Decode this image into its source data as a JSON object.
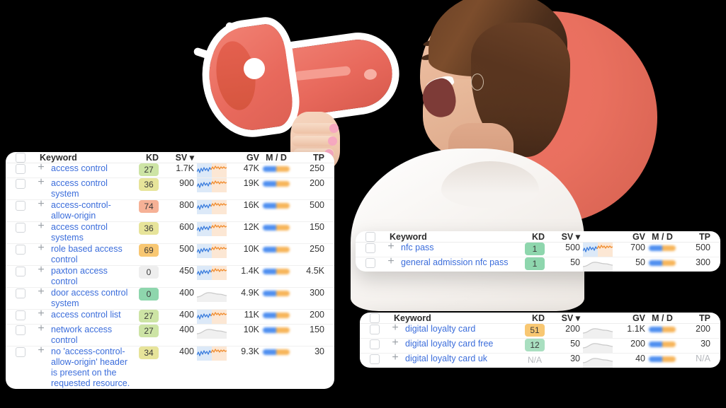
{
  "theme": {
    "accent_red": "#e8695c",
    "link_blue": "#3b6ddb",
    "kd_green": "#8ed6ad",
    "kd_light_green": "#cde4a5",
    "kd_yellow": "#e7e49a",
    "kd_orange": "#f8c772",
    "kd_salmon": "#f6b196",
    "kd_grey": "#eeeeee",
    "md_blue": "#4f8ff0",
    "md_orange": "#f7b55a"
  },
  "icons": {
    "checkbox": "checkbox-icon",
    "plus": "plus-icon",
    "sort_caret": "caret-down-icon",
    "megaphone": "megaphone-icon"
  },
  "columns": {
    "keyword": "Keyword",
    "kd": "KD",
    "sv": "SV",
    "sv_sort": "▾",
    "gv": "GV",
    "md": "M / D",
    "tp": "TP"
  },
  "tables": [
    {
      "id": "keywords-main",
      "rows": [
        {
          "keyword": "access control",
          "kd": "27",
          "kd_color": "#cde4a5",
          "sv": "1.7K",
          "gv": "47K",
          "tp": "250",
          "spark": "up"
        },
        {
          "keyword": "access control system",
          "kd": "36",
          "kd_color": "#e7e49a",
          "sv": "900",
          "gv": "19K",
          "tp": "200",
          "spark": "up"
        },
        {
          "keyword": "access-control-allow-origin",
          "kd": "74",
          "kd_color": "#f6b196",
          "sv": "800",
          "gv": "16K",
          "tp": "500",
          "spark": "up"
        },
        {
          "keyword": "access control systems",
          "kd": "36",
          "kd_color": "#e7e49a",
          "sv": "600",
          "gv": "12K",
          "tp": "150",
          "spark": "up"
        },
        {
          "keyword": "role based access control",
          "kd": "69",
          "kd_color": "#f8c772",
          "sv": "500",
          "gv": "10K",
          "tp": "250",
          "spark": "up"
        },
        {
          "keyword": "paxton access control",
          "kd": "0",
          "kd_color": "#eeeeee",
          "sv": "450",
          "gv": "1.4K",
          "tp": "4.5K",
          "spark": "up"
        },
        {
          "keyword": "door access control system",
          "kd": "0",
          "kd_color": "#8ed6ad",
          "sv": "400",
          "gv": "4.9K",
          "tp": "300",
          "spark": "flat"
        },
        {
          "keyword": "access control list",
          "kd": "27",
          "kd_color": "#cde4a5",
          "sv": "400",
          "gv": "11K",
          "tp": "200",
          "spark": "up"
        },
        {
          "keyword": "network access control",
          "kd": "27",
          "kd_color": "#cde4a5",
          "sv": "400",
          "gv": "10K",
          "tp": "150",
          "spark": "flat"
        },
        {
          "keyword": "no 'access-control-allow-origin' header is present on the requested resource.",
          "kd": "34",
          "kd_color": "#e7e49a",
          "sv": "400",
          "gv": "9.3K",
          "tp": "30",
          "spark": "up"
        }
      ]
    },
    {
      "id": "keywords-nfc",
      "rows": [
        {
          "keyword": "nfc pass",
          "kd": "1",
          "kd_color": "#8ed6ad",
          "sv": "500",
          "gv": "700",
          "tp": "500",
          "spark": "up"
        },
        {
          "keyword": "general admission nfc pass",
          "kd": "1",
          "kd_color": "#8ed6ad",
          "sv": "50",
          "gv": "50",
          "tp": "300",
          "spark": "flat"
        }
      ]
    },
    {
      "id": "keywords-loyalty",
      "rows": [
        {
          "keyword": "digital loyalty card",
          "kd": "51",
          "kd_color": "#f8c772",
          "sv": "200",
          "gv": "1.1K",
          "tp": "200",
          "spark": "flat"
        },
        {
          "keyword": "digital loyalty card free",
          "kd": "12",
          "kd_color": "#a9dfc0",
          "sv": "50",
          "gv": "200",
          "tp": "30",
          "spark": "flat"
        },
        {
          "keyword": "digital loyalty card uk",
          "kd": "N/A",
          "kd_color": "transparent",
          "sv": "30",
          "gv": "40",
          "tp": "N/A",
          "spark": "flat"
        }
      ]
    }
  ]
}
